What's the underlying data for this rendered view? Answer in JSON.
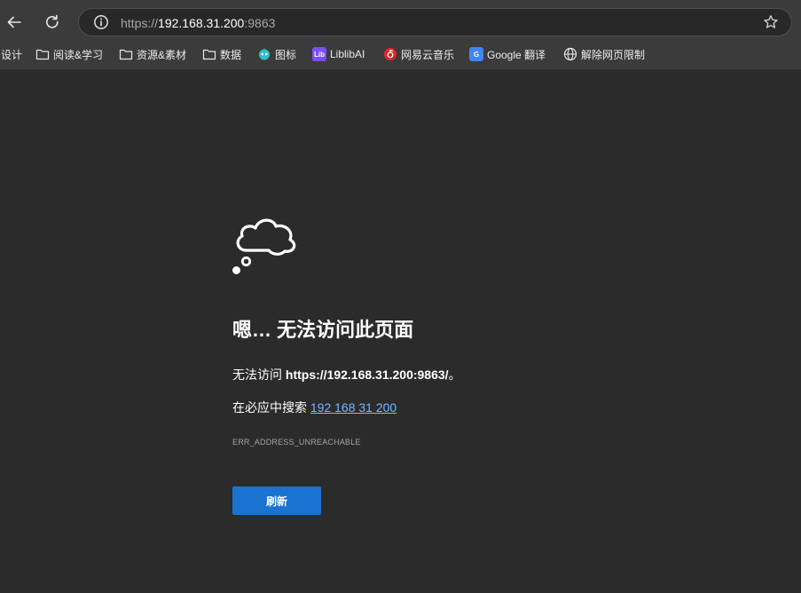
{
  "toolbar": {
    "url": {
      "scheme": "https://",
      "host": "192.168.31.200",
      "port": ":9863"
    }
  },
  "bookmarks": {
    "items": [
      {
        "label": "设计",
        "icon": "none"
      },
      {
        "label": "阅读&学习",
        "icon": "folder-icon"
      },
      {
        "label": "资源&素材",
        "icon": "folder-icon"
      },
      {
        "label": "数据",
        "icon": "folder-icon"
      },
      {
        "label": "图标",
        "icon": "iconfont-icon"
      },
      {
        "label": "LiblibAI",
        "icon": "liblib-icon",
        "badge": "Lib"
      },
      {
        "label": "网易云音乐",
        "icon": "netease-music-icon"
      },
      {
        "label": "Google 翻译",
        "icon": "google-translate-icon",
        "badge": "G"
      },
      {
        "label": "解除网页限制",
        "icon": "globe-icon"
      }
    ]
  },
  "error": {
    "title": "嗯… 无法访问此页面",
    "line1_prefix": "无法访问 ",
    "line1_url": "https://192.168.31.200:9863/",
    "line1_suffix": "。",
    "line2_prefix": "在必应中搜索 ",
    "search_link": "192 168 31 200",
    "code": "ERR_ADDRESS_UNREACHABLE",
    "refresh_label": "刷新"
  },
  "colors": {
    "background": "#2b2b2b",
    "toolbar": "#3b3b3b",
    "link": "#79b8ff",
    "button": "#1a73d0"
  }
}
